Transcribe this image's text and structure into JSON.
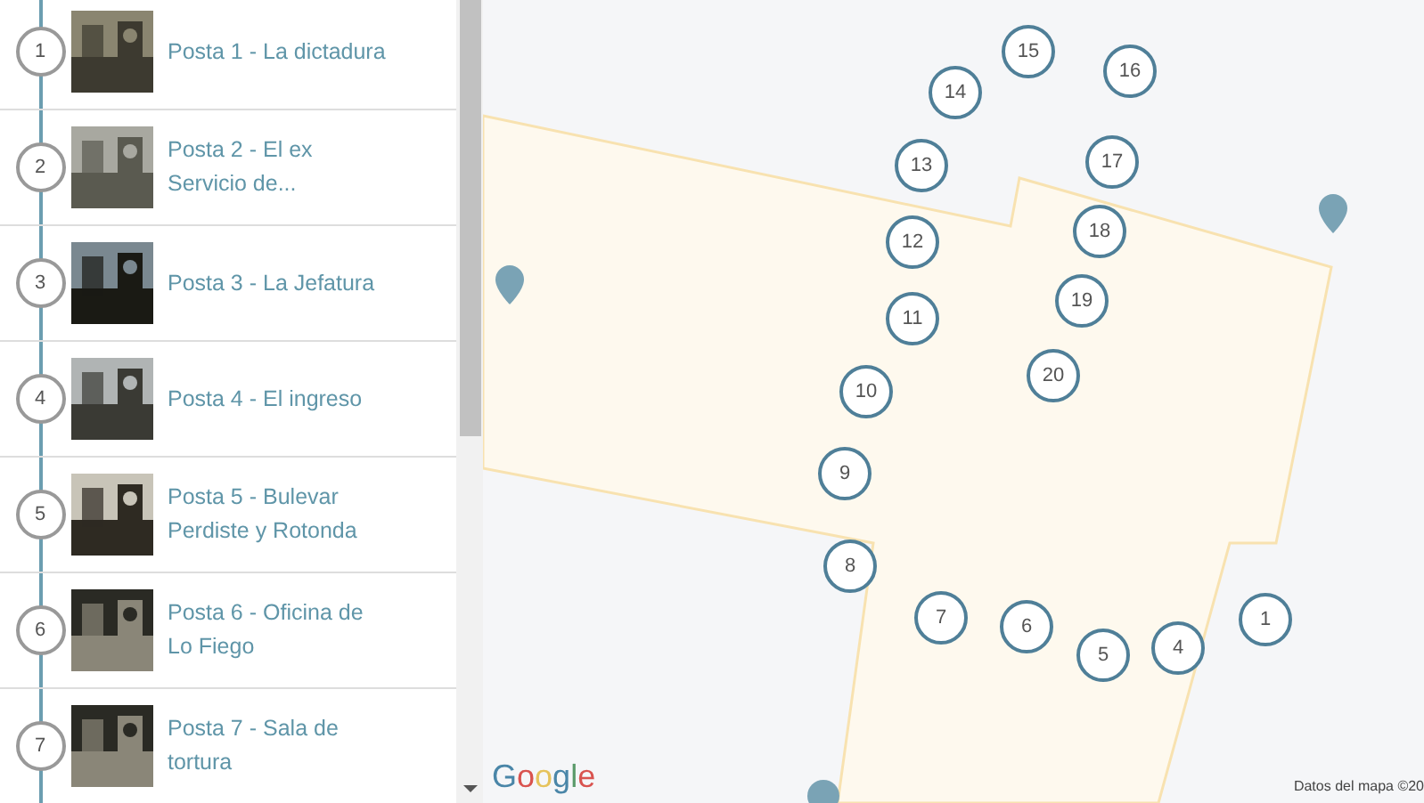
{
  "stops": [
    {
      "number": "1",
      "title": "Posta 1 - La dictadura"
    },
    {
      "number": "2",
      "title": "Posta 2 - El ex Servicio de..."
    },
    {
      "number": "3",
      "title": "Posta 3 - La Jefatura"
    },
    {
      "number": "4",
      "title": "Posta 4 - El ingreso"
    },
    {
      "number": "5",
      "title": "Posta 5 - Bulevar Perdiste y Rotonda"
    },
    {
      "number": "6",
      "title": "Posta 6 - Oficina de Lo Fiego"
    },
    {
      "number": "7",
      "title": "Posta 7 - Sala de tortura"
    }
  ],
  "map": {
    "markers": [
      "15",
      "16",
      "14",
      "17",
      "13",
      "18",
      "12",
      "19",
      "11",
      "20",
      "10",
      "9",
      "8",
      "7",
      "1",
      "6",
      "4",
      "5"
    ],
    "logo": "Google",
    "attribution": "Datos del mapa ©20"
  }
}
